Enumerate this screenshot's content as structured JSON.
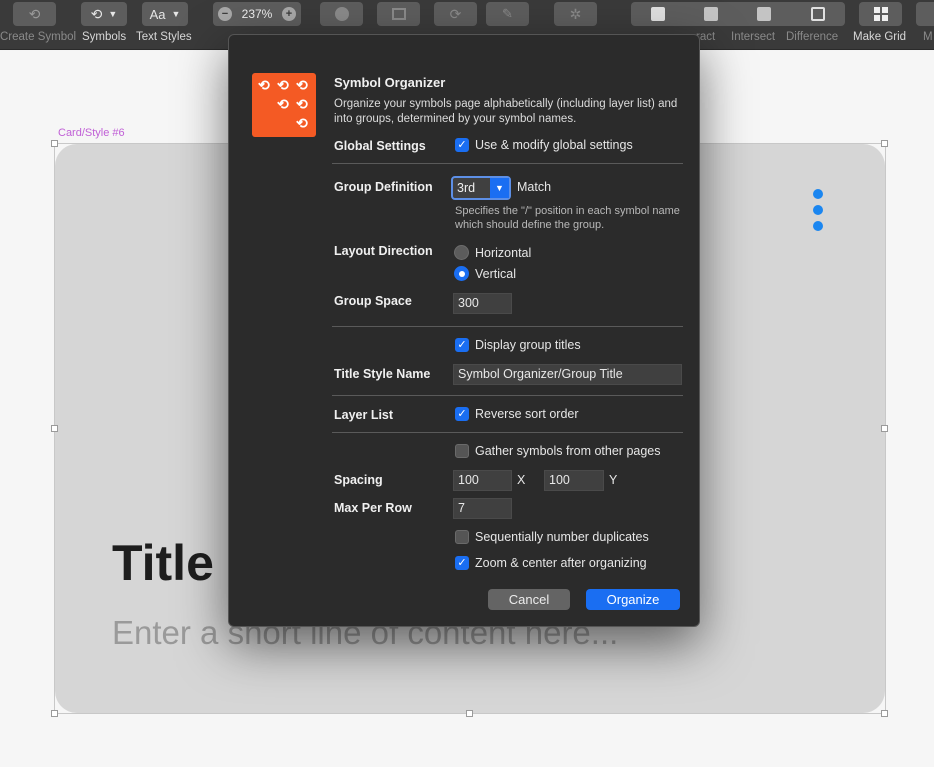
{
  "toolbar": {
    "create_symbol_label": "Create Symbol",
    "symbols_label": "Symbols",
    "text_styles_label": "Text Styles",
    "text_styles_btn": "Aa",
    "zoom_value": "237%",
    "zoom_minus": "−",
    "zoom_plus": "+",
    "subtract_label": "ract",
    "intersect_label": "Intersect",
    "difference_label": "Difference",
    "make_grid_label": "Make Grid",
    "more_label": "M"
  },
  "canvas": {
    "artboard_label": "Card/Style #6",
    "card_title": "Title",
    "card_body": "Enter a short line of content here...",
    "accent_color": "#1b86f0"
  },
  "dialog": {
    "title": "Symbol Organizer",
    "description": "Organize your symbols page alphabetically (including layer list) and into groups, determined by your symbol names.",
    "global_settings_label": "Global Settings",
    "use_global_label": "Use & modify global settings",
    "group_definition_label": "Group Definition",
    "group_definition_value": "3rd",
    "match_label": "Match",
    "group_definition_hint": "Specifies the \"/\" position in each symbol name which should define the group.",
    "layout_direction_label": "Layout Direction",
    "horizontal_label": "Horizontal",
    "vertical_label": "Vertical",
    "group_space_label": "Group Space",
    "group_space_value": "300",
    "display_group_titles_label": "Display group titles",
    "title_style_name_label": "Title Style Name",
    "title_style_name_value": "Symbol Organizer/Group Title",
    "layer_list_label": "Layer List",
    "reverse_sort_label": "Reverse sort order",
    "gather_symbols_label": "Gather symbols from other pages",
    "spacing_label": "Spacing",
    "spacing_x_value": "100",
    "spacing_x_suffix": "X",
    "spacing_y_value": "100",
    "spacing_y_suffix": "Y",
    "max_per_row_label": "Max Per Row",
    "max_per_row_value": "7",
    "sequential_label": "Sequentially number duplicates",
    "zoom_center_label": "Zoom & center after organizing",
    "cancel_label": "Cancel",
    "organize_label": "Organize",
    "icon_color": "#f45a24",
    "accent_color": "#1a6ef2"
  }
}
